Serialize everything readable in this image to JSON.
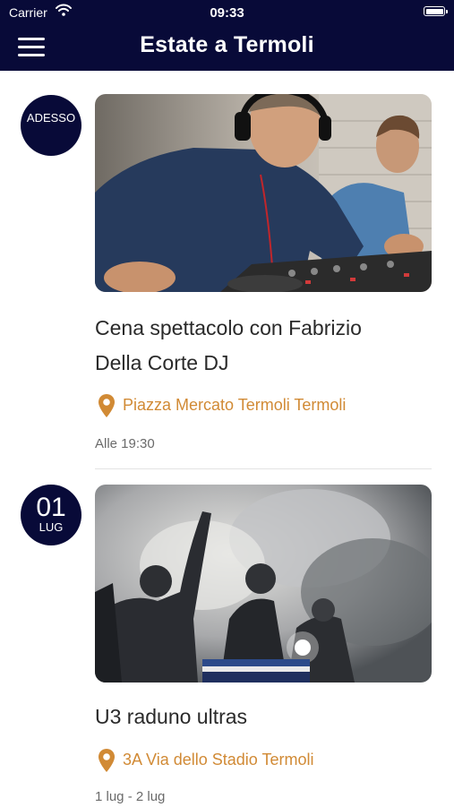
{
  "status_bar": {
    "carrier": "Carrier",
    "time": "09:33"
  },
  "header": {
    "title": "Estate a Termoli"
  },
  "events": [
    {
      "badge_text": "ADESSO",
      "title_line1": "Cena spettacolo con Fabrizio",
      "title_line2": "Della Corte DJ",
      "location": "Piazza Mercato Termoli Termoli",
      "time": "Alle 19:30"
    },
    {
      "badge_day": "01",
      "badge_month": "LUG",
      "title": "U3 raduno ultras",
      "location": "3A Via dello Stadio Termoli",
      "time": "1 lug - 2 lug"
    }
  ],
  "colors": {
    "header_bg": "#080a38",
    "accent": "#d18a35"
  }
}
